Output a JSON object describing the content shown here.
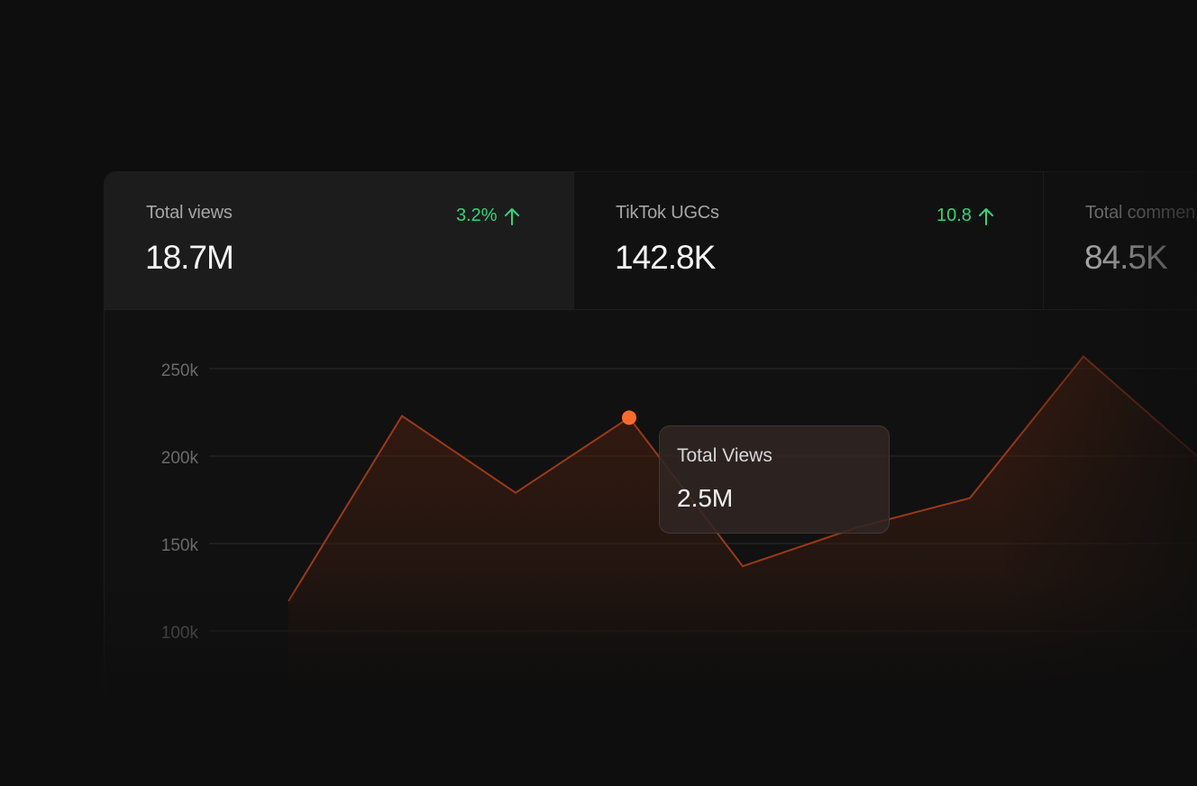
{
  "stats": [
    {
      "label": "Total views",
      "value": "18.7M",
      "change": "3.2%",
      "trend": "up"
    },
    {
      "label": "TikTok UGCs",
      "value": "142.8K",
      "change": "10.8",
      "trend": "up"
    },
    {
      "label": "Total commen",
      "value": "84.5K"
    }
  ],
  "tooltip": {
    "label": "Total Views",
    "value": "2.5M"
  },
  "colors": {
    "accent": "#ff6a2b",
    "line": "#9a3a17",
    "positive": "#2ed67a",
    "background": "#0e0e0e"
  },
  "chart_data": {
    "type": "area",
    "y_ticks": [
      "250k",
      "200k",
      "150k",
      "100k"
    ],
    "y_tick_values": [
      250000,
      200000,
      150000,
      100000
    ],
    "ylim": [
      100000,
      250000
    ],
    "values": [
      117000,
      223000,
      179000,
      222000,
      137000,
      159000,
      176000,
      257000,
      200000
    ],
    "highlight_index": 3,
    "grid": true
  }
}
